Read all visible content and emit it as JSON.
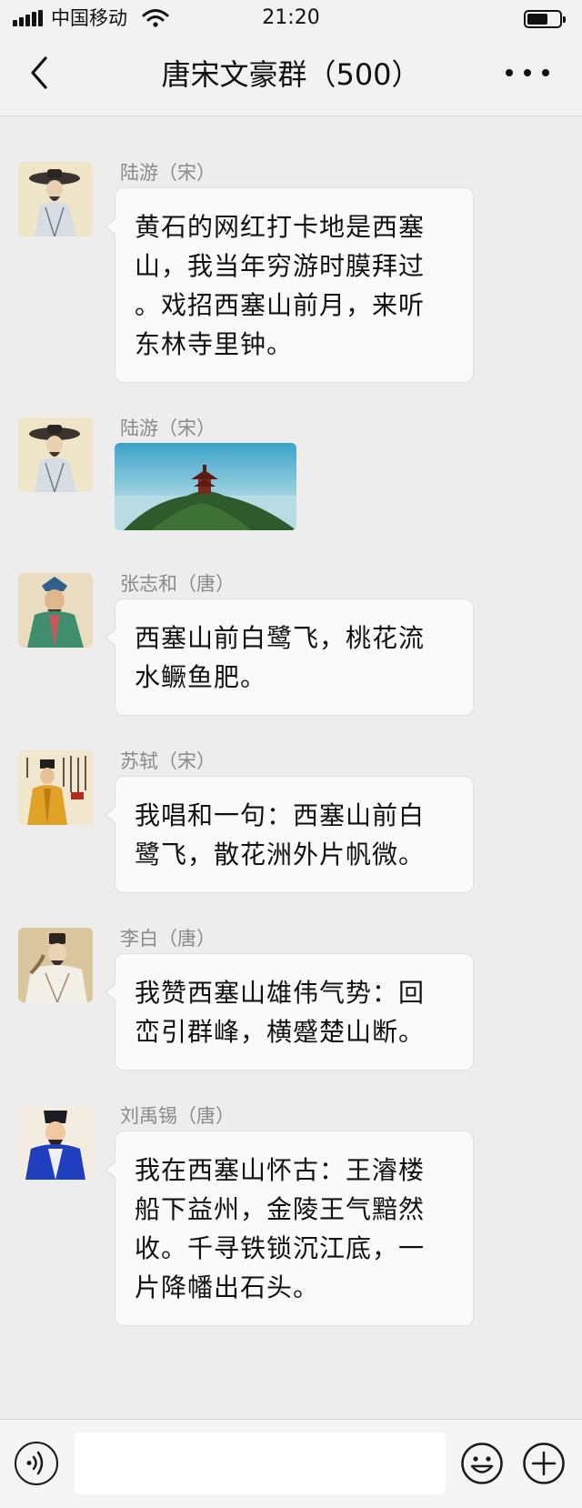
{
  "status_bar": {
    "carrier": "中国移动",
    "time": "21:20",
    "battery_level": 0.65
  },
  "nav": {
    "title": "唐宋文豪群（500）",
    "back_icon": "chevron-left-icon",
    "more_icon": "more-dots-icon"
  },
  "messages": [
    {
      "sender": "陆游（宋）",
      "type": "text",
      "lines": [
        "黄石的网红打卡地是西塞",
        "山，我当年穷游时膜拜过",
        "。戏招西塞山前月，来听",
        "东林寺里钟。"
      ]
    },
    {
      "sender": "陆游（宋）",
      "type": "image",
      "image_desc": "pavilion-on-hill-photo"
    },
    {
      "sender": "张志和（唐）",
      "type": "text",
      "lines": [
        "西塞山前白鹭飞，桃花流",
        "水鳜鱼肥。"
      ]
    },
    {
      "sender": "苏轼（宋）",
      "type": "text",
      "lines": [
        "我唱和一句：西塞山前白",
        "鹭飞，散花洲外片帆微。"
      ]
    },
    {
      "sender": "李白（唐）",
      "type": "text",
      "lines": [
        "我赞西塞山雄伟气势：回",
        "峦引群峰，横蹙楚山断。"
      ]
    },
    {
      "sender": "刘禹锡（唐）",
      "type": "text",
      "lines": [
        "我在西塞山怀古：王濬楼",
        "船下益州，金陵王气黯然",
        "收。千寻铁锁沉江底，一",
        "片降幡出石头。"
      ]
    }
  ],
  "input_bar": {
    "placeholder": "",
    "voice_icon": "voice-icon",
    "emoji_icon": "emoji-icon",
    "plus_icon": "plus-icon"
  }
}
